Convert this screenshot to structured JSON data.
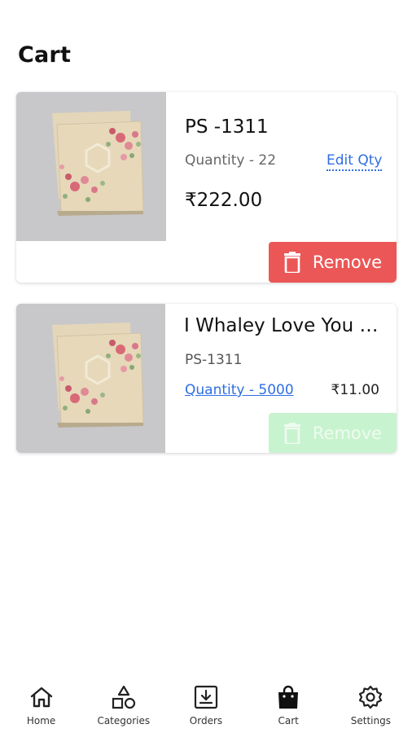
{
  "page": {
    "title": "Cart"
  },
  "cart_items": [
    {
      "title": "PS -1311",
      "quantity_text": "Quantity - 22",
      "edit_label": "Edit Qty",
      "price": "₹222.00",
      "remove_label": "Remove",
      "remove_color": "#eb5757"
    },
    {
      "title": "I Whaley Love You Card",
      "sku": "PS-1311",
      "quantity_text": "Quantity - 5000",
      "price": "₹11.00",
      "remove_label": "Remove",
      "remove_color": "#c8f3cf"
    }
  ],
  "nav": {
    "items": [
      {
        "label": "Home",
        "icon": "home-icon"
      },
      {
        "label": "Categories",
        "icon": "shapes-icon"
      },
      {
        "label": "Orders",
        "icon": "download-box-icon"
      },
      {
        "label": "Cart",
        "icon": "shopping-bag-icon",
        "active": true
      },
      {
        "label": "Settings",
        "icon": "gear-icon"
      }
    ]
  }
}
